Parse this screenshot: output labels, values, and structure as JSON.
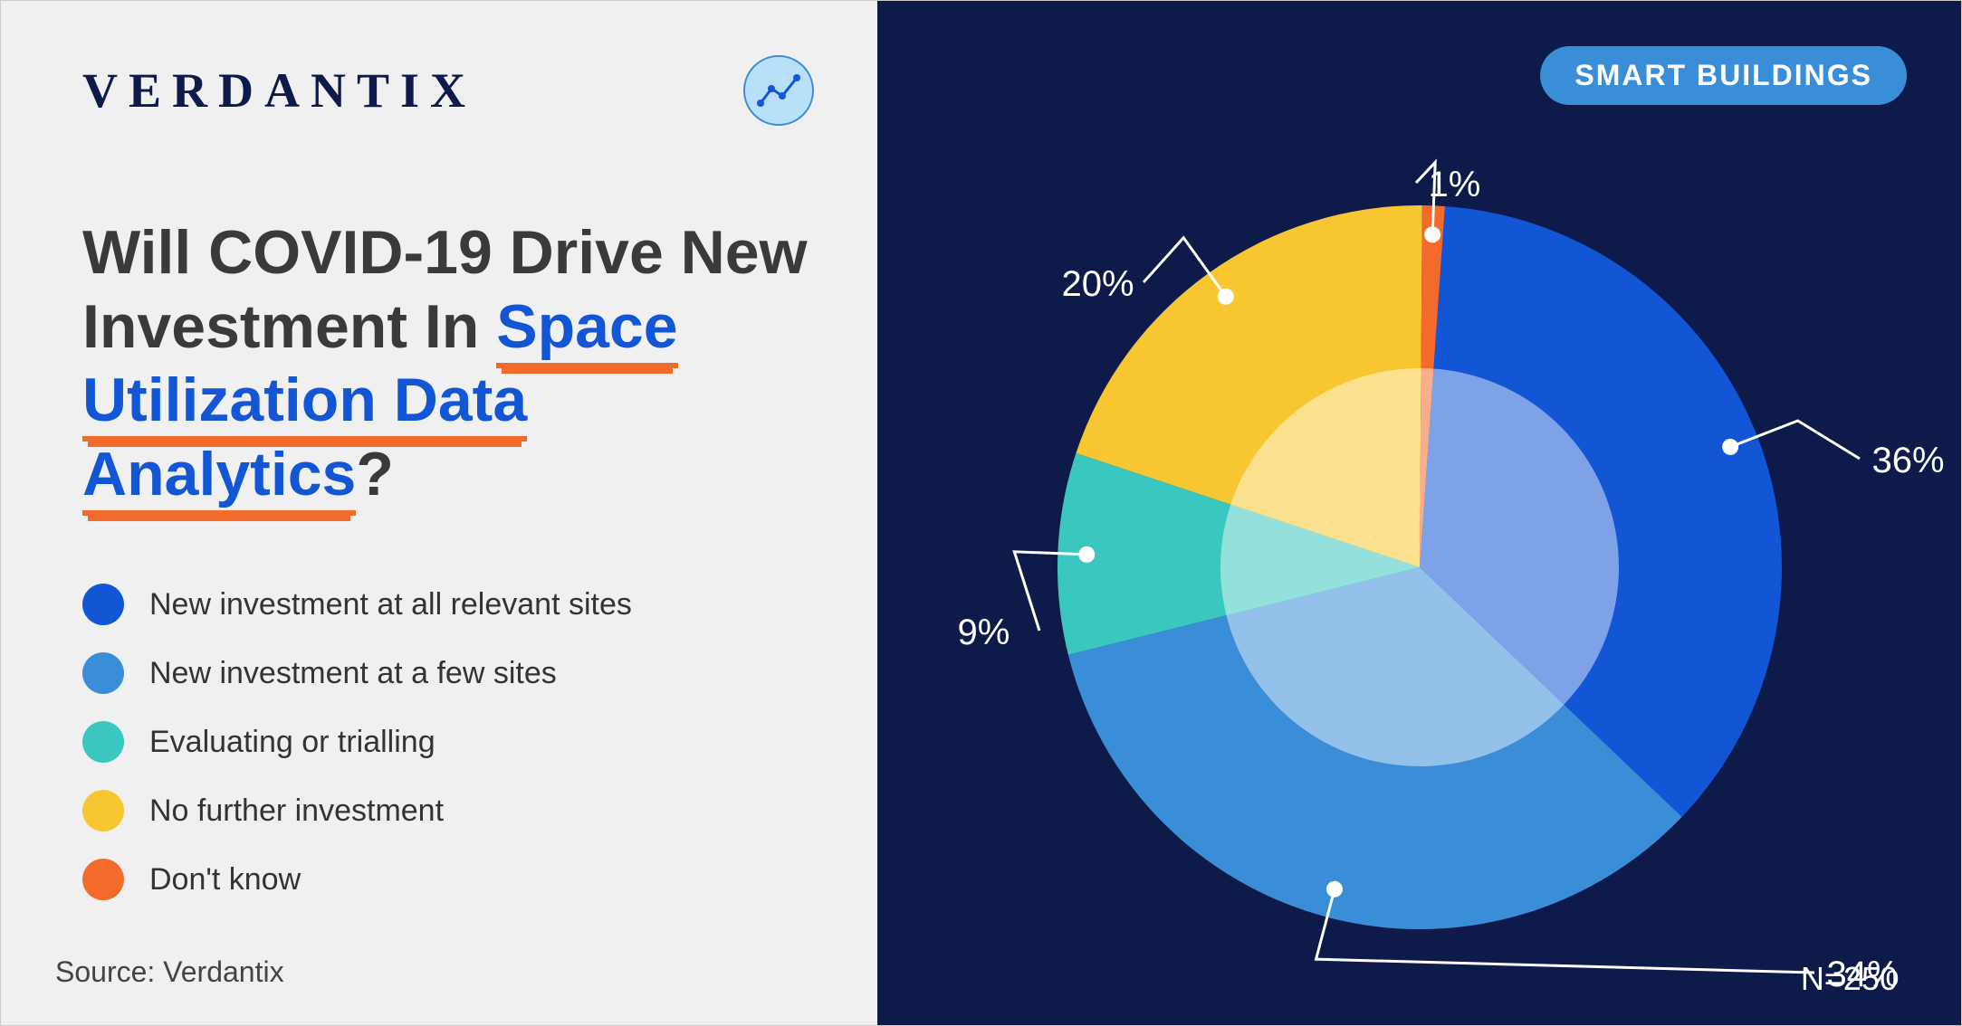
{
  "brand": "VERDANTIX",
  "title_lead": "Will COVID-19 Drive New Investment In ",
  "title_highlight": "Space Utilization Data Analytics",
  "title_tail": "?",
  "legend": [
    {
      "label": "New investment at all relevant sites",
      "color": "#1256d6"
    },
    {
      "label": "New investment at a few sites",
      "color": "#3a8ed8"
    },
    {
      "label": "Evaluating or trialling",
      "color": "#3ac7c0"
    },
    {
      "label": "No further investment",
      "color": "#f8c630"
    },
    {
      "label": "Don't know",
      "color": "#f26b2b"
    }
  ],
  "source_label": "Source: Verdantix",
  "badge": "SMART BUILDINGS",
  "sample_size": "N=250",
  "chart_data": {
    "type": "pie",
    "title": "Will COVID-19 Drive New Investment In Space Utilization Data Analytics?",
    "series": [
      {
        "name": "New investment at all relevant sites",
        "value": 36,
        "color": "#1256d6"
      },
      {
        "name": "New investment at a few sites",
        "value": 34,
        "color": "#3a8ed8"
      },
      {
        "name": "Evaluating or trialling",
        "value": 9,
        "color": "#3ac7c0"
      },
      {
        "name": "No further investment",
        "value": 20,
        "color": "#f8c630"
      },
      {
        "name": "Don't know",
        "value": 1,
        "color": "#f26b2b"
      }
    ],
    "data_labels": [
      "36%",
      "34%",
      "9%",
      "20%",
      "1%"
    ],
    "n": 250
  }
}
